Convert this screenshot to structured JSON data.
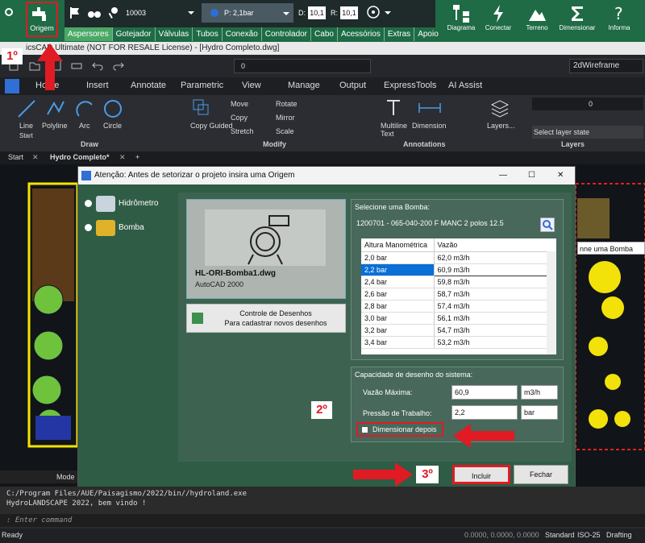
{
  "plugin_toolbar": {
    "origem_label": "Origem",
    "field_value": "10003",
    "p_value": "P: 2,1bar",
    "d_label": "D:",
    "d_value": "10,1",
    "r_label": "R:",
    "r_value": "10,1",
    "menu": [
      "Aspersores",
      "Gotejador",
      "Válvulas",
      "Tubos",
      "Conexão",
      "Controlador",
      "Cabo",
      "Acessórios",
      "Extras",
      "Apoio"
    ],
    "right_tools": [
      "Diagrama",
      "Conectar",
      "Terreno",
      "Dimensionar",
      "Informa"
    ]
  },
  "window_title": "icsCAD Ultimate (NOT FOR RESALE License) - [Hydro Completo.dwg]",
  "quick_access": {
    "layer_value": "0",
    "visual_style": "2dWireframe"
  },
  "ribbon_tabs": [
    "Home",
    "Insert",
    "Annotate",
    "Parametric",
    "View",
    "Manage",
    "Output",
    "ExpressTools",
    "AI Assist"
  ],
  "ribbon": {
    "draw_tools": [
      "Line",
      "Polyline",
      "Arc",
      "Circle"
    ],
    "draw_group": "Draw",
    "start_label": "Start",
    "copy_label": "Copy Guided",
    "modify_tools": [
      "Move",
      "Copy",
      "Stretch",
      "Rotate",
      "Mirror",
      "Scale"
    ],
    "modify_group": "Modify",
    "annotation_tools": [
      "Multiline Text",
      "Dimension"
    ],
    "annotation_group": "Annotations",
    "layers_label": "Layers...",
    "layer_state": "Select layer state",
    "layers_group": "Layers",
    "layer_value": "0"
  },
  "doc_tabs": [
    "Start",
    "Hydro Completo*"
  ],
  "model_tab": "Mode",
  "dialog": {
    "title": "Atenção: Antes de setorizar o projeto insira uma Origem",
    "options": [
      "Hidrômetro",
      "Bomba"
    ],
    "preview_file": "HL-ORI-Bomba1.dwg",
    "preview_version": "AutoCAD 2000",
    "controle_line1": "Controle de Desenhos",
    "controle_line2": "Para cadastrar novos desenhos",
    "select_pump_label": "Selecione uma Bomba:",
    "pump_model": "1200701 - 065-040-200 F MANC 2 polos 12.5",
    "table_headers": [
      "Altura Manométrica",
      "Vazão"
    ],
    "table_rows": [
      [
        "2,0 bar",
        "62,0 m3/h"
      ],
      [
        "2,2 bar",
        "60,9 m3/h"
      ],
      [
        "2,4 bar",
        "59,8 m3/h"
      ],
      [
        "2,6 bar",
        "58,7 m3/h"
      ],
      [
        "2,8 bar",
        "57,4 m3/h"
      ],
      [
        "3,0 bar",
        "56,1 m3/h"
      ],
      [
        "3,2 bar",
        "54,7 m3/h"
      ],
      [
        "3,4 bar",
        "53,2 m3/h"
      ]
    ],
    "capacity_label": "Capacidade de desenho do sistema:",
    "vazao_label": "Vazão Máxima:",
    "vazao_value": "60,9",
    "vazao_unit": "m3/h",
    "pressao_label": "Pressão de Trabalho:",
    "pressao_value": "2,2",
    "pressao_unit": "bar",
    "dimensionar_label": "Dimensionar depois",
    "incluir_label": "Incluir",
    "fechar_label": "Fechar"
  },
  "tooltip_fragment": "nne uma Bomba",
  "callouts": [
    "1º",
    "2º",
    "3º"
  ],
  "command_lines": [
    "C:/Program Files/AUE/Paisagismo/2022/bin//hydroland.exe",
    "HydroLANDSCAPE 2022, bem vindo !"
  ],
  "command_prompt": ": Enter command",
  "status": {
    "ready": "Ready",
    "coords": "0.0000, 0.0000, 0.0000",
    "items": [
      "Standard",
      "ISO-25",
      "Drafting"
    ]
  },
  "colors": {
    "plugin_green": "#1e6b45",
    "selected_row": "#0a6fd6",
    "callout_red": "#e01b24",
    "dialog_bg": "#2f5c45"
  }
}
